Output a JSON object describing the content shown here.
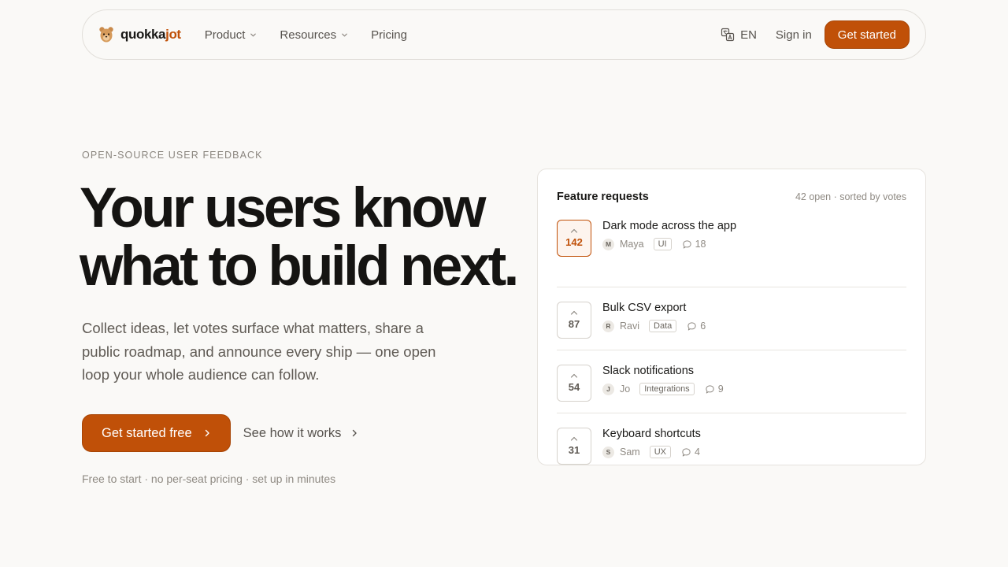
{
  "nav": {
    "logo_part1": "quokka",
    "logo_part2": "jot",
    "links": [
      {
        "label": "Product",
        "has_dropdown": true
      },
      {
        "label": "Resources",
        "has_dropdown": true
      },
      {
        "label": "Pricing",
        "has_dropdown": false
      }
    ],
    "language": "EN",
    "language_icon": "translate-icon",
    "signin_label": "Sign in",
    "cta_label": "Get started"
  },
  "hero": {
    "eyebrow": "OPEN-SOURCE USER FEEDBACK",
    "headline_line1": "Your users know",
    "headline_line2": "what to build next.",
    "subtitle": "Collect ideas, let votes surface what matters, share a public roadmap, and announce every ship — one open loop your whole audience can follow.",
    "primary_cta": "Get started free",
    "secondary_cta": "See how it works",
    "fine_print": "Free to start · no per-seat pricing · set up in minutes"
  },
  "card": {
    "title": "Feature requests",
    "meta": "42 open · sorted by votes",
    "requests": [
      {
        "votes": "142",
        "title": "Dark mode across the app",
        "author_initial": "M",
        "author": "Maya",
        "tag": "UI",
        "comments": "18",
        "active": true
      },
      {
        "votes": "87",
        "title": "Bulk CSV export",
        "author_initial": "R",
        "author": "Ravi",
        "tag": "Data",
        "comments": "6",
        "active": false
      },
      {
        "votes": "54",
        "title": "Slack notifications",
        "author_initial": "J",
        "author": "Jo",
        "tag": "Integrations",
        "comments": "9",
        "active": false
      },
      {
        "votes": "31",
        "title": "Keyboard shortcuts",
        "author_initial": "S",
        "author": "Sam",
        "tag": "UX",
        "comments": "4",
        "active": false
      }
    ]
  },
  "colors": {
    "accent": "#c05008",
    "background": "#faf9f7",
    "text": "#1a1917",
    "muted": "#8f8a83"
  }
}
